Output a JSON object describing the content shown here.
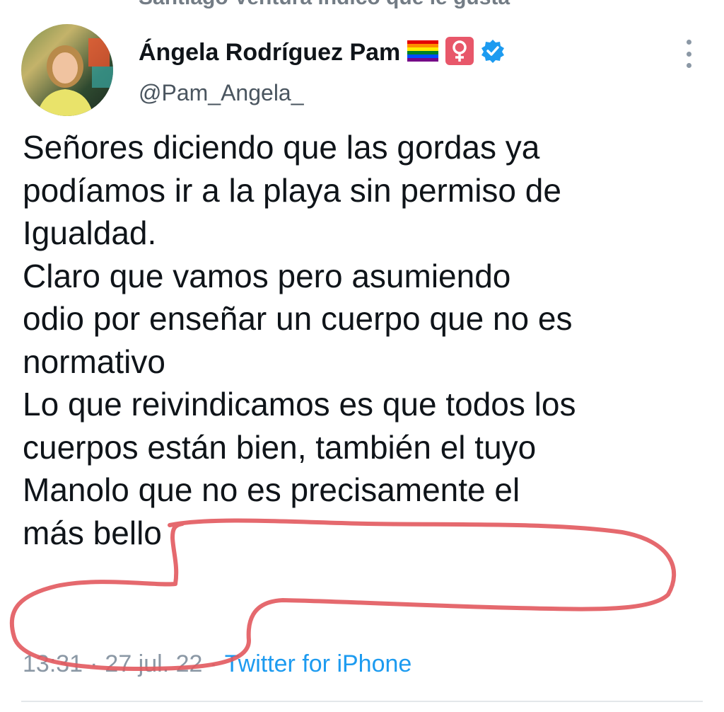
{
  "context_line": "Santiago Ventura indicó que le gusta",
  "author": {
    "display_name": "Ángela Rodríguez Pam",
    "handle": "@Pam_Angela_",
    "avatar_icon": "profile-photo",
    "badges": [
      "rainbow-flag-icon",
      "female-sign-icon",
      "verified-badge-icon"
    ]
  },
  "tweet": {
    "lines": [
      "Señores diciendo que las gordas ya",
      "podíamos ir a la playa sin permiso de",
      "Igualdad.",
      "Claro que vamos pero asumiendo",
      "odio por enseñar un cuerpo que no es",
      "normativo",
      "Lo que reivindicamos es que todos los",
      "cuerpos están bien, también el tuyo",
      "Manolo que no es precisamente el",
      "más bello"
    ]
  },
  "meta": {
    "time": "13:31",
    "separator": "·",
    "date": "27 jul. 22",
    "source": "Twitter for iPhone"
  },
  "colors": {
    "text": "#0f1419",
    "secondary": "#4a555f",
    "link": "#1d9bf0",
    "verified": "#1d9bf0",
    "annotation": "#e2595e"
  }
}
